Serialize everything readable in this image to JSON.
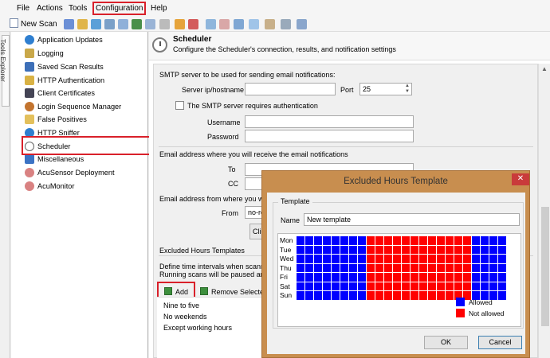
{
  "menubar": {
    "items": [
      {
        "label": "File"
      },
      {
        "label": "Actions"
      },
      {
        "label": "Tools"
      },
      {
        "label": "Configuration"
      },
      {
        "label": "Help"
      }
    ]
  },
  "toolbar": {
    "new_scan_label": "New Scan"
  },
  "tools_explorer": {
    "tab_label": "Tools Explorer"
  },
  "tree": {
    "items": [
      {
        "label": "Application Updates",
        "icon": "globe-icon"
      },
      {
        "label": "Logging",
        "icon": "logging-icon"
      },
      {
        "label": "Saved Scan Results",
        "icon": "database-icon"
      },
      {
        "label": "HTTP Authentication",
        "icon": "key-icon"
      },
      {
        "label": "Client Certificates",
        "icon": "certificate-icon"
      },
      {
        "label": "Login Sequence Manager",
        "icon": "users-icon"
      },
      {
        "label": "False Positives",
        "icon": "pencil-icon"
      },
      {
        "label": "HTTP Sniffer",
        "icon": "globe-icon"
      },
      {
        "label": "Scheduler",
        "icon": "clock-icon"
      },
      {
        "label": "Miscellaneous",
        "icon": "window-icon"
      },
      {
        "label": "AcuSensor Deployment",
        "icon": "sensor-icon"
      },
      {
        "label": "AcuMonitor",
        "icon": "monitor-icon"
      }
    ]
  },
  "header": {
    "title": "Scheduler",
    "subtitle": "Configure the Scheduler's connection, results, and notification settings"
  },
  "smtp": {
    "section_label": "SMTP server to be used for sending email notifications:",
    "server_label": "Server ip/hostname",
    "server_value": "",
    "port_label": "Port",
    "port_value": "25",
    "auth_label": "The SMTP server requires authentication",
    "username_label": "Username",
    "password_label": "Password"
  },
  "email": {
    "receive_label": "Email address where you will receive the email notifications",
    "to_label": "To",
    "cc_label": "CC",
    "from_section_label": "Email address from where you will r",
    "from_label": "From",
    "from_value": "no-re",
    "click_button": "Click"
  },
  "excluded": {
    "section_label": "Excluded Hours Templates",
    "desc_line1": "Define time intervals when scanning",
    "desc_line2": "Running scans will be paused and re",
    "add_label": "Add",
    "remove_label": "Remove Selected",
    "templates": [
      "Nine to five",
      "No weekends",
      "Except working hours"
    ]
  },
  "dialog": {
    "title": "Excluded Hours Template",
    "close_glyph": "✕",
    "group_label": "Template",
    "name_label": "Name",
    "name_value": "New template",
    "days": [
      "Mon",
      "Tue",
      "Wed",
      "Thu",
      "Fri",
      "Sat",
      "Sun"
    ],
    "allowed_hours_start": 8,
    "allowed_hours_end": 20,
    "hours_per_day": 24,
    "legend_allowed": "Allowed",
    "legend_not_allowed": "Not allowed",
    "ok_label": "OK",
    "cancel_label": "Cancel"
  },
  "colors": {
    "highlight": "#d9202a",
    "allowed": "#0000ff",
    "not_allowed": "#ff0000",
    "dialog_frame": "#c88e4f"
  }
}
